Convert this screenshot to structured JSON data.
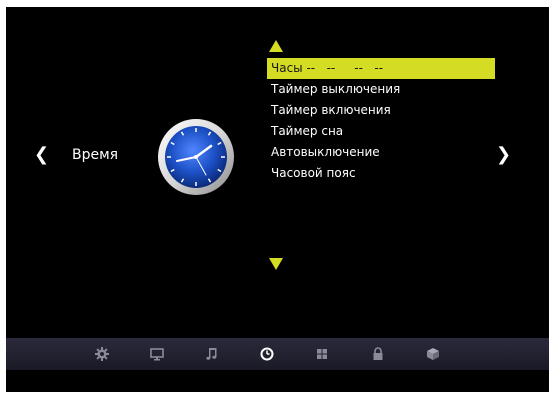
{
  "section": {
    "title": "Время",
    "prev_arrow": "❮",
    "next_arrow": "❯",
    "icon": "analog-clock-icon"
  },
  "menu": {
    "items": [
      {
        "label": "Часы",
        "value": " --   --     --   --",
        "selected": true
      },
      {
        "label": "Таймер выключения",
        "value": "",
        "selected": false
      },
      {
        "label": "Таймер включения",
        "value": "",
        "selected": false
      },
      {
        "label": "Таймер сна",
        "value": "",
        "selected": false
      },
      {
        "label": "Автовыключение",
        "value": "",
        "selected": false
      },
      {
        "label": "Часовой пояс",
        "value": "",
        "selected": false
      }
    ]
  },
  "colors": {
    "highlight": "#d4dc23",
    "background": "#000000",
    "bar": "#22222f"
  },
  "bottom_bar": {
    "icons": [
      "gear-icon",
      "monitor-icon",
      "music-note-icon",
      "clock-icon",
      "grid-icon",
      "lock-icon",
      "cube-icon"
    ],
    "active": "clock-icon"
  }
}
